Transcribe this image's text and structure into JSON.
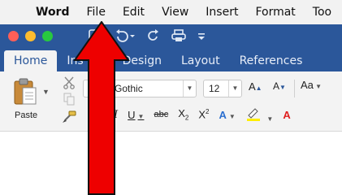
{
  "menubar": {
    "apple_glyph": "",
    "app_name": "Word",
    "items": [
      "File",
      "Edit",
      "View",
      "Insert",
      "Format",
      "Too"
    ]
  },
  "ribbon_tabs": [
    "Home",
    "Ins",
    "Design",
    "Layout",
    "References"
  ],
  "clipboard": {
    "paste_label": "Paste"
  },
  "font": {
    "name": "ntury Gothic",
    "size": "12",
    "grow_label": "A",
    "shrink_label": "A",
    "case_label": "Aa"
  },
  "format_buttons": {
    "italic": "I",
    "underline": "U",
    "strike": "abc",
    "subscript_base": "X",
    "subscript_mark": "2",
    "superscript_base": "X",
    "superscript_mark": "2",
    "effects": "A",
    "font_color": "A"
  },
  "colors": {
    "ribbon_blue": "#2b579a",
    "arrow_red": "#ee0000",
    "highlight_yellow": "#ffee00"
  }
}
